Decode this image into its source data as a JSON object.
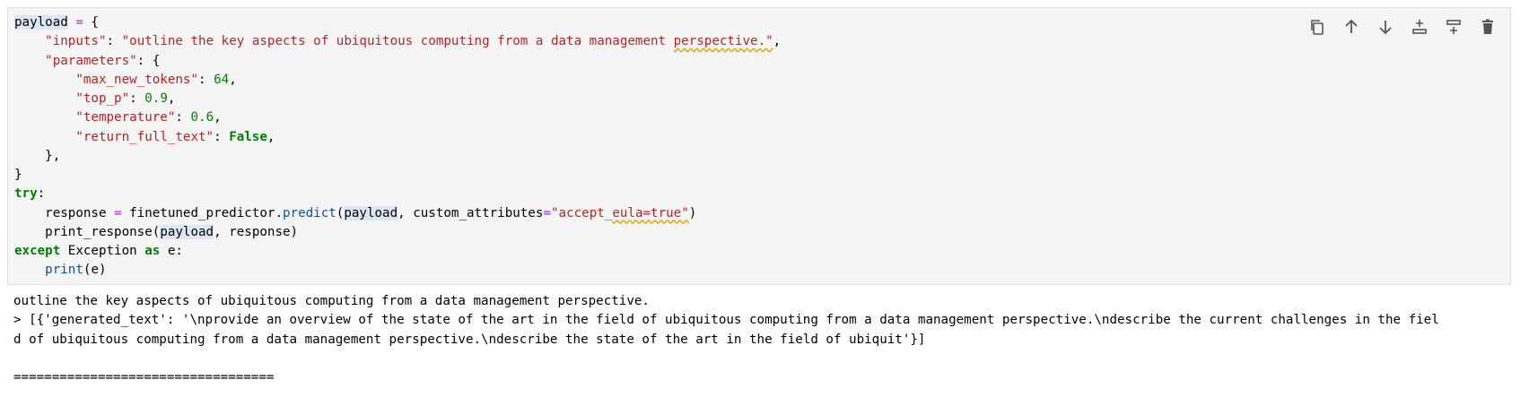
{
  "toolbar": {
    "buttons": [
      {
        "name": "copy-cell",
        "icon": "copy-icon"
      },
      {
        "name": "move-up",
        "icon": "arrow-up-icon"
      },
      {
        "name": "move-down",
        "icon": "arrow-down-icon"
      },
      {
        "name": "insert-above",
        "icon": "insert-above-icon"
      },
      {
        "name": "insert-below",
        "icon": "insert-below-icon"
      },
      {
        "name": "delete-cell",
        "icon": "trash-icon"
      }
    ]
  },
  "code": {
    "l1_var": "payload",
    "l1_rest": " = {",
    "inputs_key": "\"inputs\"",
    "inputs_val": "\"outline the key aspects of ubiquitous computing from a data management ",
    "inputs_val_squig": "perspective.\"",
    "parameters_key": "\"parameters\"",
    "max_new_tokens_key": "\"max_new_tokens\"",
    "max_new_tokens_val": "64",
    "top_p_key": "\"top_p\"",
    "top_p_val": "0.9",
    "temperature_key": "\"temperature\"",
    "temperature_val": "0.6",
    "return_full_text_key": "\"return_full_text\"",
    "return_full_text_val": "False",
    "kw_try": "try",
    "response_var": "response",
    "predictor": "finetuned_predictor",
    "predict_fn": "predict",
    "payload_arg": "payload",
    "custom_attr": "custom_attributes",
    "eula_str_a": "\"accept_",
    "eula_str_b": "eula=true\"",
    "print_response_fn": "print_response",
    "payload_arg2": "payload",
    "response_arg": "response",
    "kw_except": "except",
    "exception_cls": "Exception",
    "kw_as": "as",
    "e_var": "e",
    "print_fn": "print",
    "print_arg": "e"
  },
  "output": {
    "line1": "outline the key aspects of ubiquitous computing from a data management perspective.",
    "line2": "> [{'generated_text': '\\nprovide an overview of the state of the art in the field of ubiquitous computing from a data management perspective.\\ndescribe the current challenges in the fiel",
    "line3": "d of ubiquitous computing from a data management perspective.\\ndescribe the state of the art in the field of ubiquit'}]",
    "line4": "",
    "separator": "=================================="
  }
}
